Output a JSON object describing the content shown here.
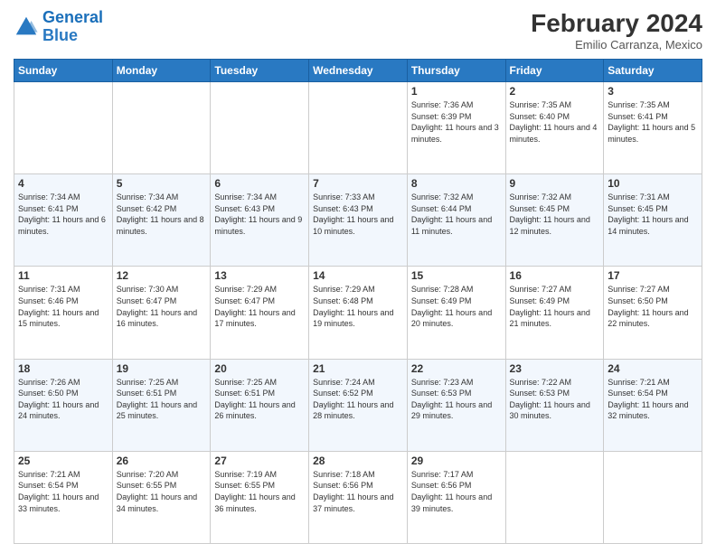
{
  "logo": {
    "line1": "General",
    "line2": "Blue"
  },
  "title": "February 2024",
  "subtitle": "Emilio Carranza, Mexico",
  "days_of_week": [
    "Sunday",
    "Monday",
    "Tuesday",
    "Wednesday",
    "Thursday",
    "Friday",
    "Saturday"
  ],
  "weeks": [
    [
      {
        "day": "",
        "sunrise": "",
        "sunset": "",
        "daylight": ""
      },
      {
        "day": "",
        "sunrise": "",
        "sunset": "",
        "daylight": ""
      },
      {
        "day": "",
        "sunrise": "",
        "sunset": "",
        "daylight": ""
      },
      {
        "day": "",
        "sunrise": "",
        "sunset": "",
        "daylight": ""
      },
      {
        "day": "1",
        "sunrise": "Sunrise: 7:36 AM",
        "sunset": "Sunset: 6:39 PM",
        "daylight": "Daylight: 11 hours and 3 minutes."
      },
      {
        "day": "2",
        "sunrise": "Sunrise: 7:35 AM",
        "sunset": "Sunset: 6:40 PM",
        "daylight": "Daylight: 11 hours and 4 minutes."
      },
      {
        "day": "3",
        "sunrise": "Sunrise: 7:35 AM",
        "sunset": "Sunset: 6:41 PM",
        "daylight": "Daylight: 11 hours and 5 minutes."
      }
    ],
    [
      {
        "day": "4",
        "sunrise": "Sunrise: 7:34 AM",
        "sunset": "Sunset: 6:41 PM",
        "daylight": "Daylight: 11 hours and 6 minutes."
      },
      {
        "day": "5",
        "sunrise": "Sunrise: 7:34 AM",
        "sunset": "Sunset: 6:42 PM",
        "daylight": "Daylight: 11 hours and 8 minutes."
      },
      {
        "day": "6",
        "sunrise": "Sunrise: 7:34 AM",
        "sunset": "Sunset: 6:43 PM",
        "daylight": "Daylight: 11 hours and 9 minutes."
      },
      {
        "day": "7",
        "sunrise": "Sunrise: 7:33 AM",
        "sunset": "Sunset: 6:43 PM",
        "daylight": "Daylight: 11 hours and 10 minutes."
      },
      {
        "day": "8",
        "sunrise": "Sunrise: 7:32 AM",
        "sunset": "Sunset: 6:44 PM",
        "daylight": "Daylight: 11 hours and 11 minutes."
      },
      {
        "day": "9",
        "sunrise": "Sunrise: 7:32 AM",
        "sunset": "Sunset: 6:45 PM",
        "daylight": "Daylight: 11 hours and 12 minutes."
      },
      {
        "day": "10",
        "sunrise": "Sunrise: 7:31 AM",
        "sunset": "Sunset: 6:45 PM",
        "daylight": "Daylight: 11 hours and 14 minutes."
      }
    ],
    [
      {
        "day": "11",
        "sunrise": "Sunrise: 7:31 AM",
        "sunset": "Sunset: 6:46 PM",
        "daylight": "Daylight: 11 hours and 15 minutes."
      },
      {
        "day": "12",
        "sunrise": "Sunrise: 7:30 AM",
        "sunset": "Sunset: 6:47 PM",
        "daylight": "Daylight: 11 hours and 16 minutes."
      },
      {
        "day": "13",
        "sunrise": "Sunrise: 7:29 AM",
        "sunset": "Sunset: 6:47 PM",
        "daylight": "Daylight: 11 hours and 17 minutes."
      },
      {
        "day": "14",
        "sunrise": "Sunrise: 7:29 AM",
        "sunset": "Sunset: 6:48 PM",
        "daylight": "Daylight: 11 hours and 19 minutes."
      },
      {
        "day": "15",
        "sunrise": "Sunrise: 7:28 AM",
        "sunset": "Sunset: 6:49 PM",
        "daylight": "Daylight: 11 hours and 20 minutes."
      },
      {
        "day": "16",
        "sunrise": "Sunrise: 7:27 AM",
        "sunset": "Sunset: 6:49 PM",
        "daylight": "Daylight: 11 hours and 21 minutes."
      },
      {
        "day": "17",
        "sunrise": "Sunrise: 7:27 AM",
        "sunset": "Sunset: 6:50 PM",
        "daylight": "Daylight: 11 hours and 22 minutes."
      }
    ],
    [
      {
        "day": "18",
        "sunrise": "Sunrise: 7:26 AM",
        "sunset": "Sunset: 6:50 PM",
        "daylight": "Daylight: 11 hours and 24 minutes."
      },
      {
        "day": "19",
        "sunrise": "Sunrise: 7:25 AM",
        "sunset": "Sunset: 6:51 PM",
        "daylight": "Daylight: 11 hours and 25 minutes."
      },
      {
        "day": "20",
        "sunrise": "Sunrise: 7:25 AM",
        "sunset": "Sunset: 6:51 PM",
        "daylight": "Daylight: 11 hours and 26 minutes."
      },
      {
        "day": "21",
        "sunrise": "Sunrise: 7:24 AM",
        "sunset": "Sunset: 6:52 PM",
        "daylight": "Daylight: 11 hours and 28 minutes."
      },
      {
        "day": "22",
        "sunrise": "Sunrise: 7:23 AM",
        "sunset": "Sunset: 6:53 PM",
        "daylight": "Daylight: 11 hours and 29 minutes."
      },
      {
        "day": "23",
        "sunrise": "Sunrise: 7:22 AM",
        "sunset": "Sunset: 6:53 PM",
        "daylight": "Daylight: 11 hours and 30 minutes."
      },
      {
        "day": "24",
        "sunrise": "Sunrise: 7:21 AM",
        "sunset": "Sunset: 6:54 PM",
        "daylight": "Daylight: 11 hours and 32 minutes."
      }
    ],
    [
      {
        "day": "25",
        "sunrise": "Sunrise: 7:21 AM",
        "sunset": "Sunset: 6:54 PM",
        "daylight": "Daylight: 11 hours and 33 minutes."
      },
      {
        "day": "26",
        "sunrise": "Sunrise: 7:20 AM",
        "sunset": "Sunset: 6:55 PM",
        "daylight": "Daylight: 11 hours and 34 minutes."
      },
      {
        "day": "27",
        "sunrise": "Sunrise: 7:19 AM",
        "sunset": "Sunset: 6:55 PM",
        "daylight": "Daylight: 11 hours and 36 minutes."
      },
      {
        "day": "28",
        "sunrise": "Sunrise: 7:18 AM",
        "sunset": "Sunset: 6:56 PM",
        "daylight": "Daylight: 11 hours and 37 minutes."
      },
      {
        "day": "29",
        "sunrise": "Sunrise: 7:17 AM",
        "sunset": "Sunset: 6:56 PM",
        "daylight": "Daylight: 11 hours and 39 minutes."
      },
      {
        "day": "",
        "sunrise": "",
        "sunset": "",
        "daylight": ""
      },
      {
        "day": "",
        "sunrise": "",
        "sunset": "",
        "daylight": ""
      }
    ]
  ]
}
